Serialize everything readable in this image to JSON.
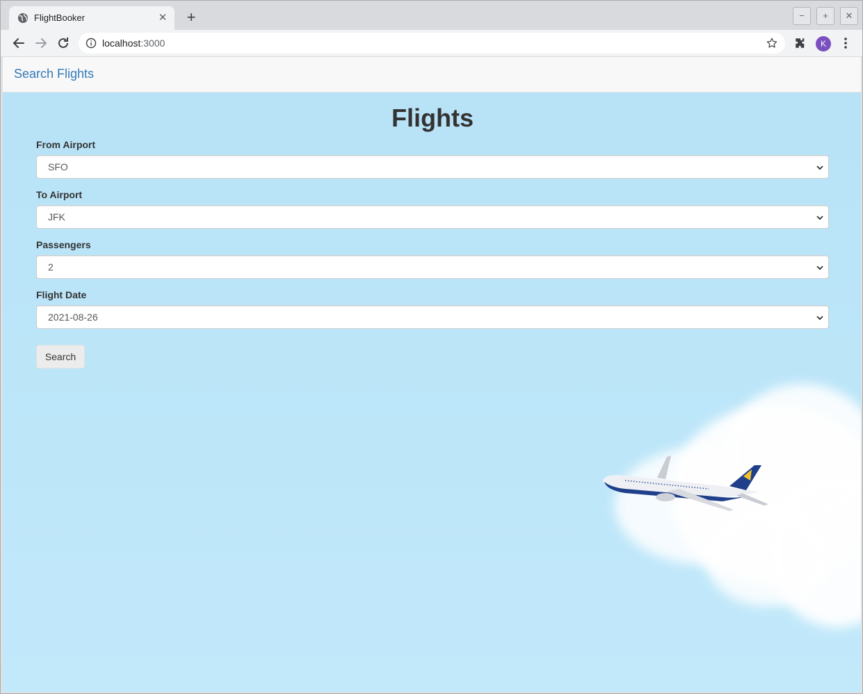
{
  "browser": {
    "tab_title": "FlightBooker",
    "url_host": "localhost",
    "url_port": ":3000",
    "profile_initial": "K"
  },
  "navbar": {
    "brand_label": "Search Flights"
  },
  "main": {
    "title": "Flights",
    "fields": [
      {
        "label": "From Airport",
        "value": "SFO"
      },
      {
        "label": "To Airport",
        "value": "JFK"
      },
      {
        "label": "Passengers",
        "value": "2"
      },
      {
        "label": "Flight Date",
        "value": "2021-08-26"
      }
    ],
    "search_button_label": "Search"
  },
  "colors": {
    "sky": "#b7e2f6",
    "brand_link": "#337ab7",
    "avatar": "#7b4fc0",
    "plane_body": "#1f3f8a",
    "plane_tail_accent": "#f2c12e"
  },
  "icons": {
    "tab_favicon": "globe-icon",
    "tab_close": "close-icon",
    "new_tab": "plus-icon",
    "back": "arrow-left-icon",
    "forward": "arrow-right-icon",
    "reload": "reload-icon",
    "site_info": "info-icon",
    "bookmark": "star-icon",
    "extensions": "puzzle-icon",
    "menu": "kebab-menu-icon",
    "select_chevron": "chevron-down-icon"
  }
}
